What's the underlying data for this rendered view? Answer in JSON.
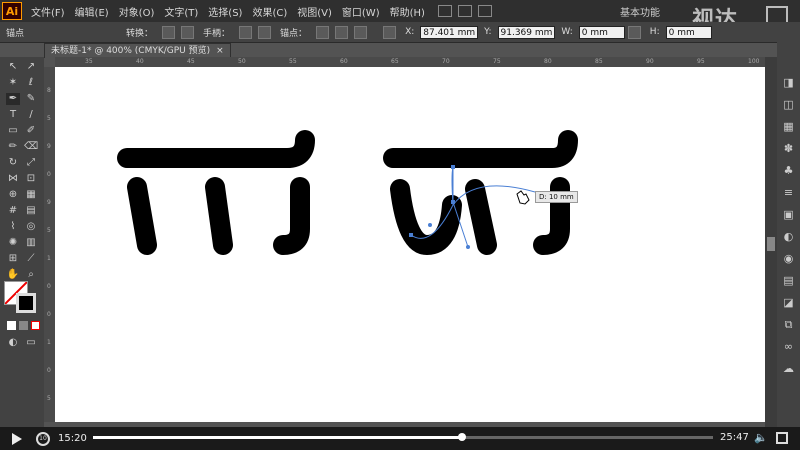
{
  "app": {
    "logo": "Ai"
  },
  "menu": [
    "文件(F)",
    "编辑(E)",
    "对象(O)",
    "文字(T)",
    "选择(S)",
    "效果(C)",
    "视图(V)",
    "窗口(W)",
    "帮助(H)"
  ],
  "workspace": "基本功能",
  "watermark": "视达",
  "control": {
    "anchor_label": "锚点",
    "convert_label": "转换：",
    "handle_label": "手柄：",
    "anchors_label": "锚点：",
    "x_value": "87.401 mm",
    "y_value": "91.369 mm",
    "w_value": "0 mm",
    "h_value": "0 mm"
  },
  "document_tab": {
    "title": "未标题-1* @ 400% (CMYK/GPU 预览)",
    "close": "×"
  },
  "ruler_top_ticks": [
    "35",
    "40",
    "45",
    "50",
    "55",
    "60",
    "65",
    "70",
    "75",
    "80",
    "85",
    "90",
    "95",
    "100"
  ],
  "ruler_left_ticks": [
    "8",
    "5",
    "9",
    "0",
    "9",
    "5",
    "1",
    "0",
    "0",
    "1",
    "0",
    "5"
  ],
  "tooltip": "D: 10 mm",
  "colors": {
    "stroke": "#000000",
    "path": "#4a7fd4",
    "accent": "#ff9a00"
  },
  "video": {
    "current_time": "15:20",
    "total_time": "25:47",
    "progress": 0.595
  }
}
